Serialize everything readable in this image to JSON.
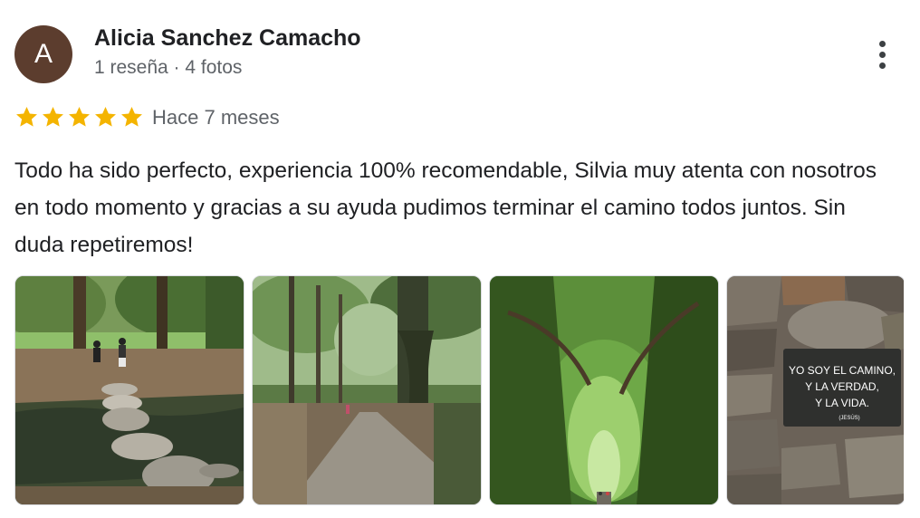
{
  "reviewer": {
    "avatar_letter": "A",
    "name": "Alicia Sanchez Camacho",
    "meta": "1 reseña · 4 fotos"
  },
  "rating": {
    "stars": 5,
    "max": 5,
    "star_color": "#f4b400"
  },
  "time": "Hace 7 meses",
  "review_text": "Todo ha sido perfecto, experiencia 100% recomendable, Silvia muy atenta con nosotros en todo momento y gracias a su ayuda pudimos terminar el camino todos juntos. Sin duda repetiremos!",
  "photos": [
    {
      "icon": "photo-stream-crossing"
    },
    {
      "icon": "photo-forest-path"
    },
    {
      "icon": "photo-tree-tunnel"
    },
    {
      "icon": "photo-stone-wall-sign",
      "sign_lines": [
        "YO SOY EL CAMINO,",
        "Y LA VERDAD,",
        "Y LA VIDA."
      ],
      "sign_attribution": "(JESÚS)"
    }
  ],
  "more_icon": "more-vert-icon",
  "colors": {
    "avatar": "#5c3d2e",
    "secondary_text": "#5f6368"
  }
}
